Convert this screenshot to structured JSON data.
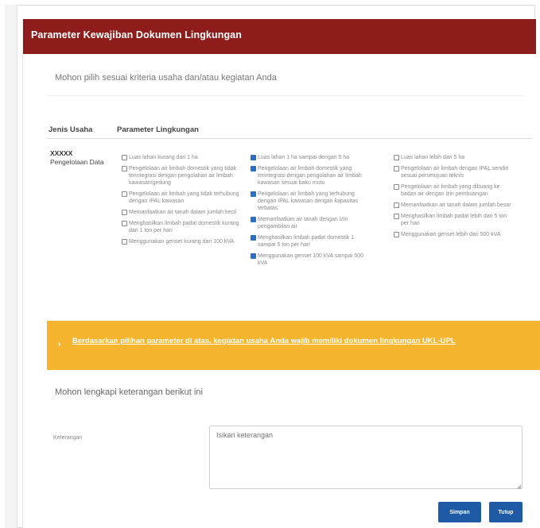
{
  "modal": {
    "title": "Parameter Kewajiban Dokumen Lingkungan",
    "intro": "Mohon pilih sesuai kriteria usaha dan/atau kegiatan Anda"
  },
  "table": {
    "headers": [
      "Jenis Usaha",
      "Parameter Lingkungan"
    ],
    "jenis_usaha": {
      "code": "XXXXX",
      "name": "Pengelolaan Data"
    }
  },
  "options": {
    "col1": [
      {
        "label": "Luas lahan kurang dari 1 ha",
        "checked": false
      },
      {
        "label": "Pengelolaan air limbah domestik yang tidak terintegrasi dengan pengolahan air limbah kawasan/gedung",
        "checked": false
      },
      {
        "label": "Pengelolaan air limbah yang tidak terhubung dengan IPAL kawasan",
        "checked": false
      },
      {
        "label": "Memanfaatkan air tanah dalam jumlah kecil",
        "checked": false
      },
      {
        "label": "Menghasilkan limbah padat domestik kurang dari 1 ton per hari",
        "checked": false
      },
      {
        "label": "Menggunakan genset kurang dari 100 kVA",
        "checked": false
      }
    ],
    "col2": [
      {
        "label": "Luas lahan 1 ha sampai dengan 5 ha",
        "checked": true
      },
      {
        "label": "Pengelolaan air limbah domestik yang terintegrasi dengan pengolahan air limbah kawasan sesuai baku mutu",
        "checked": true
      },
      {
        "label": "Pengelolaan air limbah yang terhubung dengan IPAL kawasan dengan kapasitas terbatas",
        "checked": true
      },
      {
        "label": "Memanfaatkan air tanah dengan izin pengambilan air",
        "checked": true
      },
      {
        "label": "Menghasilkan limbah padat domestik 1 sampai 5 ton per hari",
        "checked": true
      },
      {
        "label": "Menggunakan genset 100 kVA sampai 500 kVA",
        "checked": true
      }
    ],
    "col3": [
      {
        "label": "Luas lahan lebih dari 5 ha",
        "checked": false
      },
      {
        "label": "Pengelolaan air limbah dengan IPAL sendiri sesuai persetujuan teknis",
        "checked": false
      },
      {
        "label": "Pengelolaan air limbah yang dibuang ke badan air dengan izin pembuangan",
        "checked": false
      },
      {
        "label": "Memanfaatkan air tanah dalam jumlah besar",
        "checked": false
      },
      {
        "label": "Menghasilkan limbah padat lebih dari 5 ton per hari",
        "checked": false
      },
      {
        "label": "Menggunakan genset lebih dari 500 kVA",
        "checked": false
      }
    ]
  },
  "banner": {
    "icon": "info-icon",
    "text": "Berdasarkan pilihan parameter di atas, kegiatan usaha Anda wajib memiliki dokumen lingkungan UKL-UPL"
  },
  "notes": {
    "prompt": "Mohon lengkapi keterangan berikut ini",
    "label": "Keterangan",
    "placeholder": "Isikan keterangan"
  },
  "buttons": {
    "save": "Simpan",
    "close": "Tutup"
  },
  "colors": {
    "header": "#8e1c1a",
    "banner": "#f6b52e",
    "button": "#1f5aa6",
    "checked": "#2b6fc4"
  }
}
